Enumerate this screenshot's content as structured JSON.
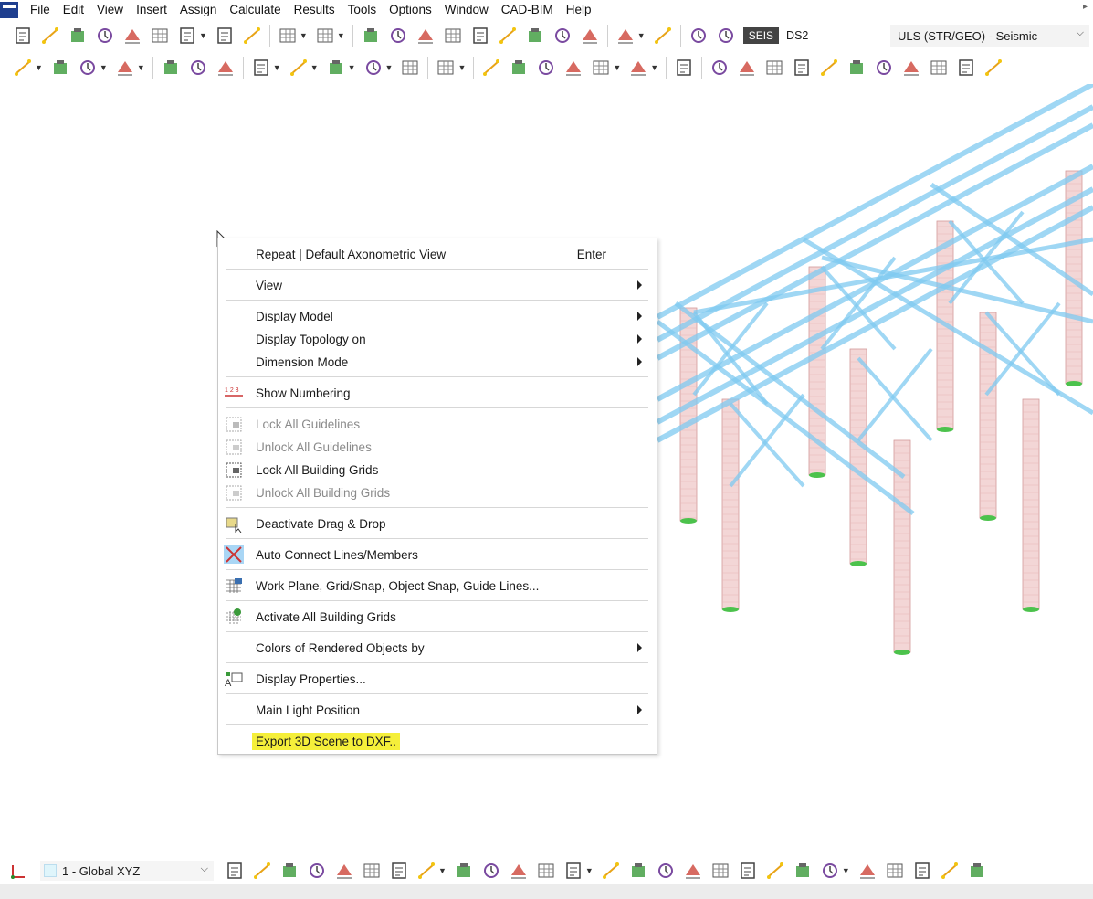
{
  "menu": {
    "items": [
      "File",
      "Edit",
      "View",
      "Insert",
      "Assign",
      "Calculate",
      "Results",
      "Tools",
      "Options",
      "Window",
      "CAD-BIM",
      "Help"
    ]
  },
  "toolbar": {
    "seis_badge": "SEIS",
    "design_situation": "DS2",
    "load_combination": "ULS (STR/GEO) - Seismic"
  },
  "context_menu": {
    "items": [
      {
        "label": "Repeat | Default Axonometric View",
        "shortcut": "Enter",
        "submenu": false,
        "disabled": false,
        "icon": ""
      },
      {
        "label": "View",
        "submenu": true,
        "disabled": false,
        "icon": ""
      },
      {
        "label": "Display Model",
        "submenu": true,
        "disabled": false,
        "icon": ""
      },
      {
        "label": "Display Topology on",
        "submenu": true,
        "disabled": false,
        "icon": ""
      },
      {
        "label": "Dimension Mode",
        "submenu": true,
        "disabled": false,
        "icon": ""
      },
      {
        "label": "Show Numbering",
        "submenu": false,
        "disabled": false,
        "icon": "numbering-icon"
      },
      {
        "label": "Lock All Guidelines",
        "submenu": false,
        "disabled": true,
        "icon": "lock-guidelines-icon"
      },
      {
        "label": "Unlock All Guidelines",
        "submenu": false,
        "disabled": true,
        "icon": "unlock-guidelines-icon"
      },
      {
        "label": "Lock All Building Grids",
        "submenu": false,
        "disabled": false,
        "icon": "lock-grids-icon"
      },
      {
        "label": "Unlock All Building Grids",
        "submenu": false,
        "disabled": true,
        "icon": "unlock-grids-icon"
      },
      {
        "label": "Deactivate Drag & Drop",
        "submenu": false,
        "disabled": false,
        "icon": "drag-drop-icon"
      },
      {
        "label": "Auto Connect Lines/Members",
        "submenu": false,
        "disabled": false,
        "icon": "auto-connect-icon"
      },
      {
        "label": "Work Plane, Grid/Snap, Object Snap, Guide Lines...",
        "submenu": false,
        "disabled": false,
        "icon": "work-plane-icon"
      },
      {
        "label": "Activate All Building Grids",
        "submenu": false,
        "disabled": false,
        "icon": "activate-grids-icon"
      },
      {
        "label": "Colors of Rendered Objects by",
        "submenu": true,
        "disabled": false,
        "icon": ""
      },
      {
        "label": "Display Properties...",
        "submenu": false,
        "disabled": false,
        "icon": "display-properties-icon"
      },
      {
        "label": "Main Light Position",
        "submenu": true,
        "disabled": false,
        "icon": ""
      },
      {
        "label": "Export 3D Scene to DXF..",
        "submenu": false,
        "disabled": false,
        "icon": "",
        "highlighted": true
      }
    ]
  },
  "bottom": {
    "coordinate_system": "1 - Global XYZ"
  },
  "colors": {
    "member_blue": "#7fcaf0",
    "column_fill": "#f3d6d6",
    "support_green": "#4cc24c",
    "highlight": "#f5ef3a"
  }
}
